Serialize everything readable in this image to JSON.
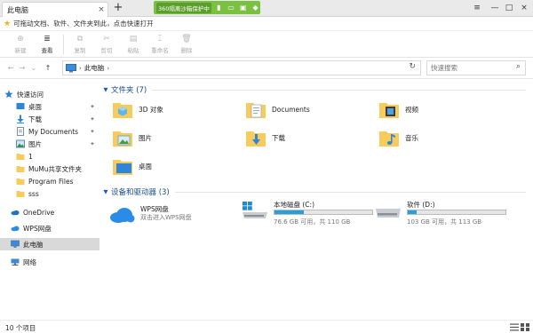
{
  "titlebar": {
    "tab_label": "此电脑",
    "tab_close": "×",
    "new_tab": "+",
    "sandbox_label": "360隔离沙箱保护中",
    "window_buttons": {
      "menu": "≡",
      "minimize": "—",
      "maximize": "□",
      "close": "×"
    }
  },
  "tipbar": {
    "text": "可拖动文档、软件、文件夹到此，点击快速打开"
  },
  "ribbon": {
    "buttons": [
      {
        "label": "新建",
        "icon": "new-icon",
        "glyph": "⊕"
      },
      {
        "label": "查看",
        "icon": "view-icon",
        "glyph": "≣"
      },
      {
        "label": "复制",
        "icon": "copy-icon",
        "glyph": "⧉"
      },
      {
        "label": "剪切",
        "icon": "cut-icon",
        "glyph": "✂"
      },
      {
        "label": "粘贴",
        "icon": "paste-icon",
        "glyph": "▤"
      },
      {
        "label": "重命名",
        "icon": "rename-icon",
        "glyph": "⌶"
      },
      {
        "label": "删除",
        "icon": "delete-icon",
        "glyph": "🗑"
      }
    ]
  },
  "navbar": {
    "back": "←",
    "forward": "→",
    "history": "⌄",
    "up": "↑",
    "path": "此电脑",
    "path_chevron": "›",
    "refresh": "↻",
    "search_placeholder": "快速搜索",
    "search_glyph": "⌕"
  },
  "sidebar": {
    "items": [
      {
        "label": "快速访问",
        "icon": "star-icon",
        "pinned": false
      },
      {
        "label": "桌面",
        "icon": "desktop-icon",
        "pinned": true
      },
      {
        "label": "下载",
        "icon": "download-icon",
        "pinned": true
      },
      {
        "label": "My Documents",
        "icon": "documents-icon",
        "pinned": true
      },
      {
        "label": "图片",
        "icon": "pictures-icon",
        "pinned": true
      },
      {
        "label": "1",
        "icon": "folder-icon",
        "pinned": false
      },
      {
        "label": "MuMu共享文件夹",
        "icon": "folder-icon",
        "pinned": false
      },
      {
        "label": "Program Files",
        "icon": "folder-icon",
        "pinned": false
      },
      {
        "label": "sss",
        "icon": "folder-icon",
        "pinned": false
      },
      {
        "label": "OneDrive",
        "icon": "onedrive-icon",
        "pinned": false
      },
      {
        "label": "WPS网盘",
        "icon": "wps-cloud-icon",
        "pinned": false
      },
      {
        "label": "此电脑",
        "icon": "this-pc-icon",
        "pinned": false,
        "selected": true
      },
      {
        "label": "网络",
        "icon": "network-icon",
        "pinned": false
      }
    ],
    "pin_glyph": "📌"
  },
  "folders_group": {
    "title": "文件夹 (7)",
    "items": [
      {
        "label": "3D 对象",
        "icon": "3d-objects-folder-icon"
      },
      {
        "label": "Documents",
        "icon": "documents-folder-icon"
      },
      {
        "label": "视频",
        "icon": "videos-folder-icon"
      },
      {
        "label": "图片",
        "icon": "pictures-folder-icon"
      },
      {
        "label": "下载",
        "icon": "downloads-folder-icon"
      },
      {
        "label": "音乐",
        "icon": "music-folder-icon"
      },
      {
        "label": "桌面",
        "icon": "desktop-folder-icon"
      }
    ]
  },
  "devices_group": {
    "title": "设备和驱动器 (3)",
    "items": [
      {
        "name": "WPS网盘",
        "sub": "双击进入WPS网盘",
        "icon": "wps-cloud-drive-icon"
      },
      {
        "name": "本地磁盘 (C:)",
        "sub": "76.6 GB 可用，共 110 GB",
        "used_fraction": 0.304,
        "icon": "windows-drive-icon"
      },
      {
        "name": "软件 (D:)",
        "sub": "103 GB 可用，共 113 GB",
        "used_fraction": 0.088,
        "icon": "drive-icon"
      }
    ]
  },
  "statusbar": {
    "count": "10 个项目"
  },
  "colors": {
    "accent": "#1a5fb4",
    "folder": "#f7cc5c",
    "sandbox_green": "#7ac142",
    "drive_fill": "#26a0da",
    "selected_bg": "#d9d9d9"
  }
}
